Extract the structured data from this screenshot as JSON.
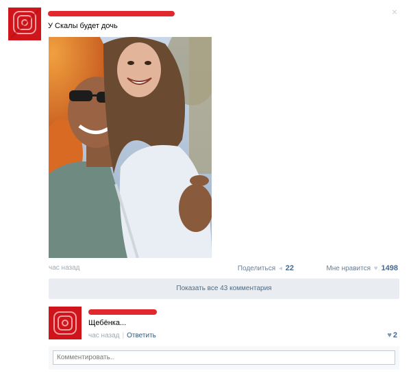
{
  "post": {
    "text": "У Скалы будет дочь",
    "close_icon": "×",
    "photo_icon": "photo-of-couple"
  },
  "meta": {
    "time": "час назад",
    "share_label": "Поделиться",
    "share_count": "22",
    "like_label": "Мне нравится",
    "like_count": "1498"
  },
  "comments": {
    "show_all_label": "Показать все 43 комментария",
    "items": [
      {
        "text": "Щебёнка...",
        "time": "час назад",
        "reply_label": "Ответить",
        "like_count": "2"
      }
    ],
    "input_placeholder": "Комментировать.."
  },
  "colors": {
    "avatar_red": "#d0141b",
    "link_blue": "#45688e",
    "button_bg": "#e9edf1"
  }
}
